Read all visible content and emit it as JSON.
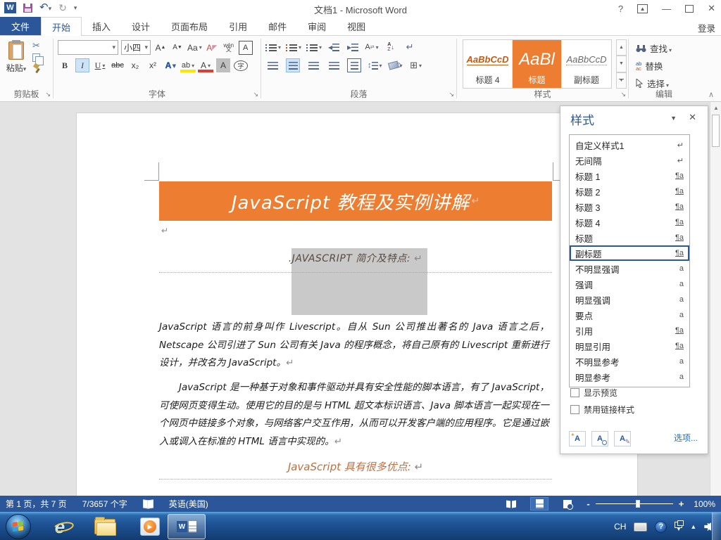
{
  "titlebar": {
    "title": "文档1 - Microsoft Word",
    "help": "?",
    "minimize": "—",
    "close": "✕"
  },
  "tabs": {
    "file": "文件",
    "items": [
      "开始",
      "插入",
      "设计",
      "页面布局",
      "引用",
      "邮件",
      "审阅",
      "视图"
    ],
    "sign_in": "登录"
  },
  "ribbon": {
    "clipboard": {
      "label": "剪贴板",
      "paste_label": "粘贴"
    },
    "font": {
      "label": "字体",
      "font_name_value": "",
      "font_size_value": "小四",
      "grow": "A",
      "shrink": "A",
      "change_case": "Aa",
      "clear": "A",
      "phonetic_top": "wén",
      "phonetic_bottom": "文",
      "char_border": "A",
      "bold": "B",
      "italic": "I",
      "underline": "U",
      "strike": "abc",
      "subscript": "x₂",
      "superscript": "x²",
      "effects": "A",
      "highlight": "ab",
      "font_color": "A",
      "char_shading": "A",
      "enclose": "字"
    },
    "paragraph": {
      "label": "段落",
      "sort_a": "A",
      "sort_z": "Z",
      "sort_arrow": "↓",
      "marks": "↵",
      "asian": "A"
    },
    "styles": {
      "label": "样式",
      "gallery": [
        {
          "preview": "AaBbCcD",
          "name": "标题 4"
        },
        {
          "preview": "AaBl",
          "name": "标题"
        },
        {
          "preview": "AaBbCcD",
          "name": "副标题"
        }
      ],
      "scroll_up": "▲",
      "scroll_down": "▼",
      "scroll_more": "▼"
    },
    "editing": {
      "label": "编辑",
      "find": "查找",
      "replace": "替换",
      "select": "选择",
      "replace_top": "ab",
      "replace_bottom": "ac"
    }
  },
  "document": {
    "title": "JavaScript 教程及实例讲解",
    "heading1": ".JAVASCRIPT 简介及特点: ",
    "para1": "JavaScript 语言的前身叫作 Livescript。自从 Sun 公司推出著名的 Java 语言之后，Netscape 公司引进了 Sun 公司有关 Java 的程序概念，将自己原有的 Livescript 重新进行设计，并改名为 JavaScript。",
    "para2": "JavaScript 是一种基于对象和事件驱动并具有安全性能的脚本语言，有了 JavaScript，可使网页变得生动。使用它的目的是与 HTML 超文本标识语言、Java 脚本语言一起实现在一个网页中链接多个对象，与网络客户交互作用，从而可以开发客户端的应用程序。它是通过嵌入或调入在标准的 HTML 语言中实现的。",
    "heading2": "JavaScript 具有很多优点: ",
    "pilcrow": "↵"
  },
  "styles_panel": {
    "title": "样式",
    "items": [
      {
        "name": "自定义样式1",
        "symbol": "↵",
        "symclass": "sym"
      },
      {
        "name": "无间隔",
        "symbol": "↵",
        "symclass": "sym"
      },
      {
        "name": "标题 1",
        "symbol": "¶a",
        "symclass": "sym linked"
      },
      {
        "name": "标题 2",
        "symbol": "¶a",
        "symclass": "sym linked"
      },
      {
        "name": "标题 3",
        "symbol": "¶a",
        "symclass": "sym linked"
      },
      {
        "name": "标题 4",
        "symbol": "¶a",
        "symclass": "sym linked"
      },
      {
        "name": "标题",
        "symbol": "¶a",
        "symclass": "sym linked"
      },
      {
        "name": "副标题",
        "symbol": "¶a",
        "symclass": "sym linked"
      },
      {
        "name": "不明显强调",
        "symbol": "a",
        "symclass": "sym"
      },
      {
        "name": "强调",
        "symbol": "a",
        "symclass": "sym"
      },
      {
        "name": "明显强调",
        "symbol": "a",
        "symclass": "sym"
      },
      {
        "name": "要点",
        "symbol": "a",
        "symclass": "sym"
      },
      {
        "name": "引用",
        "symbol": "¶a",
        "symclass": "sym linked"
      },
      {
        "name": "明显引用",
        "symbol": "¶a",
        "symclass": "sym linked"
      },
      {
        "name": "不明显参考",
        "symbol": "a",
        "symclass": "sym"
      },
      {
        "name": "明显参考",
        "symbol": "a",
        "symclass": "sym"
      }
    ],
    "show_preview": "显示预览",
    "disable_linked_styles": "禁用链接样式",
    "new_style_letter": "A",
    "inspector_letter": "A",
    "manage_letter": "A",
    "options": "选项..."
  },
  "status_bar": {
    "page_info": "第 1 页，共 7 页",
    "word_count": "7/3657 个字",
    "language": "英语(美国)",
    "zoom_level": "100%",
    "zoom_minus": "-",
    "zoom_plus": "+"
  },
  "taskbar": {
    "tray_language": "CH",
    "tray_help": "?",
    "hidden_icons": "▲",
    "ie_letter": "e",
    "wmp_play": "▶",
    "word_letter": "W"
  },
  "colors": {
    "accent_orange": "#ED7D31",
    "word_blue": "#2B579A"
  }
}
